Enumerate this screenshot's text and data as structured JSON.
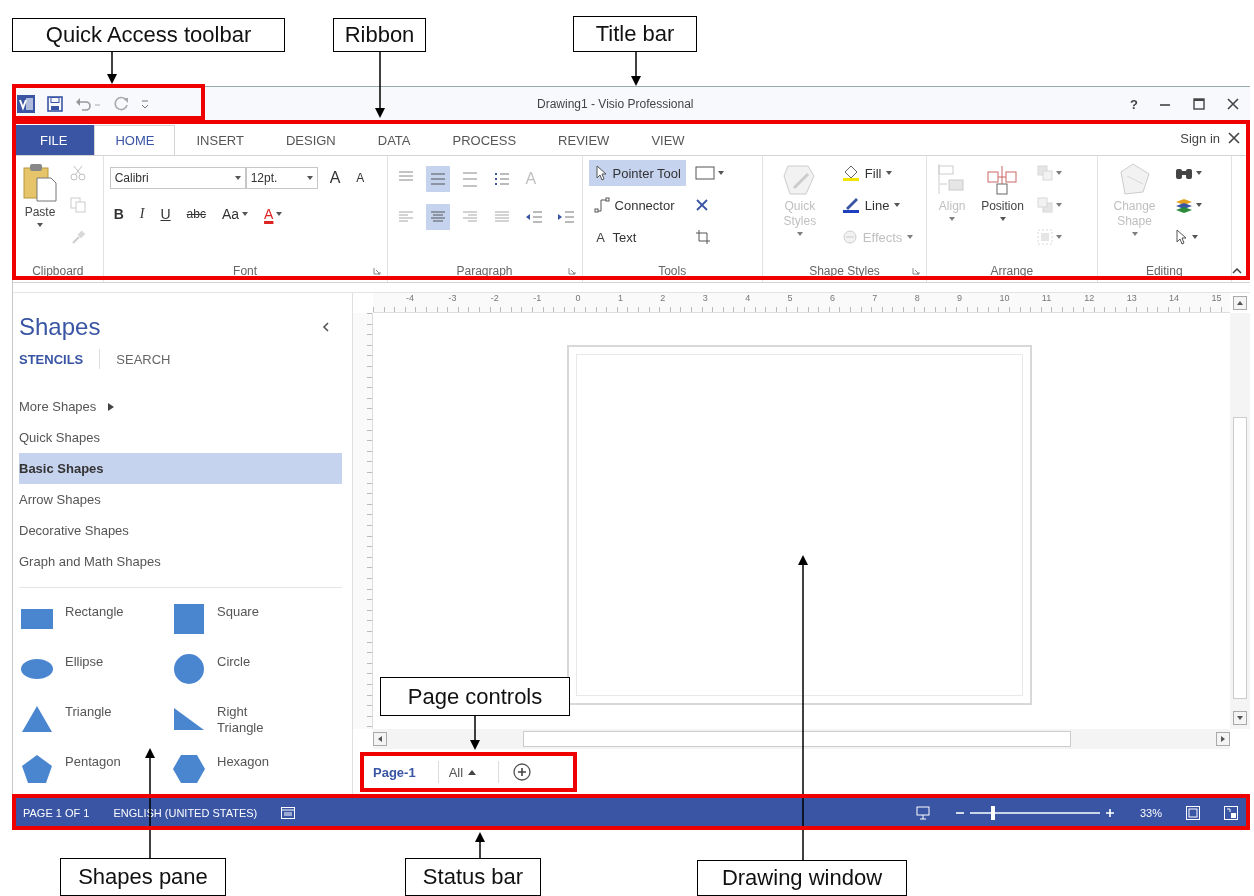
{
  "annotations": [
    {
      "label": "Quick Access toolbar",
      "highlighted": true
    },
    {
      "label": "Ribbon",
      "highlighted": true
    },
    {
      "label": "Title bar",
      "highlighted": false
    },
    {
      "label": "Page controls",
      "highlighted": true
    },
    {
      "label": "Shapes pane",
      "highlighted": false
    },
    {
      "label": "Status bar",
      "highlighted": true
    },
    {
      "label": "Drawing window",
      "highlighted": false
    }
  ],
  "window": {
    "title": "Drawing1 - Visio Professional",
    "help": "?"
  },
  "ribbon": {
    "tabs": [
      {
        "label": "FILE",
        "kind": "file",
        "selected": false
      },
      {
        "label": "HOME",
        "kind": "tab",
        "selected": true
      },
      {
        "label": "INSERT",
        "kind": "tab",
        "selected": false
      },
      {
        "label": "DESIGN",
        "kind": "tab",
        "selected": false
      },
      {
        "label": "DATA",
        "kind": "tab",
        "selected": false
      },
      {
        "label": "PROCESS",
        "kind": "tab",
        "selected": false
      },
      {
        "label": "REVIEW",
        "kind": "tab",
        "selected": false
      },
      {
        "label": "VIEW",
        "kind": "tab",
        "selected": false
      }
    ],
    "sign_in": "Sign in",
    "groups": [
      {
        "label": "Clipboard",
        "launcher": false,
        "kind": "columns",
        "lines": [
          [
            {
              "kind": "large",
              "label": "Paste",
              "dropdown": true,
              "disabled": false
            }
          ],
          [
            {
              "kind": "icon",
              "disabled": true,
              "dropdown": false
            },
            {
              "kind": "icon",
              "disabled": true,
              "dropdown": false
            },
            {
              "kind": "icon",
              "disabled": true,
              "dropdown": false
            }
          ]
        ]
      },
      {
        "label": "Font",
        "launcher": true,
        "kind": "rows",
        "lines": [
          [
            {
              "kind": "field",
              "value": "Calibri"
            },
            {
              "kind": "field",
              "value": "12pt."
            },
            {
              "kind": "glyph",
              "label": "A",
              "disabled": false,
              "dropdown": false
            },
            {
              "kind": "glyph",
              "label": "A",
              "disabled": false,
              "dropdown": false
            }
          ],
          [
            {
              "kind": "glyph",
              "label": "B",
              "disabled": false,
              "dropdown": false
            },
            {
              "kind": "glyph",
              "label": "I",
              "disabled": false,
              "dropdown": false
            },
            {
              "kind": "glyph",
              "label": "U",
              "disabled": false,
              "dropdown": false
            },
            {
              "kind": "glyph",
              "label": "abc",
              "disabled": false,
              "dropdown": false
            },
            {
              "kind": "glyph",
              "label": "Aa",
              "disabled": false,
              "dropdown": true
            },
            {
              "kind": "glyph",
              "label": "A",
              "disabled": false,
              "dropdown": true
            }
          ]
        ]
      },
      {
        "label": "Paragraph",
        "launcher": true,
        "kind": "rows",
        "lines": [
          [
            {
              "kind": "icon",
              "disabled": false,
              "selected": false
            },
            {
              "kind": "icon",
              "disabled": false,
              "selected": true
            },
            {
              "kind": "icon",
              "disabled": false,
              "selected": false
            },
            {
              "kind": "icon",
              "disabled": false,
              "selected": false
            },
            {
              "kind": "glyph",
              "label": "A",
              "disabled": true,
              "dropdown": false
            }
          ],
          [
            {
              "kind": "icon",
              "disabled": true,
              "selected": false
            },
            {
              "kind": "icon",
              "disabled": false,
              "selected": true
            },
            {
              "kind": "icon",
              "disabled": true,
              "selected": false
            },
            {
              "kind": "icon",
              "disabled": true,
              "selected": false
            },
            {
              "kind": "icon",
              "disabled": false,
              "selected": false
            },
            {
              "kind": "icon",
              "disabled": false,
              "selected": false
            }
          ]
        ]
      },
      {
        "label": "Tools",
        "launcher": false,
        "kind": "columns",
        "lines": [
          [
            {
              "kind": "small",
              "label": "Pointer Tool",
              "selected": true,
              "disabled": false,
              "dropdown": false
            },
            {
              "kind": "small",
              "label": "Connector",
              "selected": false,
              "disabled": false,
              "dropdown": false
            },
            {
              "kind": "small",
              "glyph": "A",
              "label": "Text",
              "selected": false,
              "disabled": false,
              "dropdown": false
            }
          ],
          [
            {
              "kind": "icon",
              "disabled": false,
              "dropdown": true
            },
            {
              "kind": "icon",
              "disabled": false,
              "dropdown": false
            },
            {
              "kind": "icon",
              "disabled": false,
              "dropdown": false
            }
          ]
        ]
      },
      {
        "label": "Shape Styles",
        "launcher": true,
        "kind": "columns",
        "lines": [
          [
            {
              "kind": "large",
              "label": "Quick Styles",
              "dropdown": true,
              "disabled": true
            }
          ],
          [
            {
              "kind": "small",
              "label": "Fill",
              "dropdown": true,
              "disabled": false,
              "selected": false
            },
            {
              "kind": "small",
              "label": "Line",
              "dropdown": true,
              "disabled": false,
              "selected": false
            },
            {
              "kind": "small",
              "label": "Effects",
              "dropdown": true,
              "disabled": true,
              "selected": false
            }
          ]
        ]
      },
      {
        "label": "Arrange",
        "launcher": false,
        "kind": "columns",
        "lines": [
          [
            {
              "kind": "large",
              "label": "Align",
              "dropdown": true,
              "disabled": true
            }
          ],
          [
            {
              "kind": "large",
              "label": "Position",
              "dropdown": true,
              "disabled": false
            }
          ],
          [
            {
              "kind": "icon",
              "disabled": true,
              "dropdown": true
            },
            {
              "kind": "icon",
              "disabled": true,
              "dropdown": true
            },
            {
              "kind": "icon",
              "disabled": true,
              "dropdown": true
            }
          ]
        ]
      },
      {
        "label": "Editing",
        "launcher": false,
        "kind": "columns",
        "lines": [
          [
            {
              "kind": "large",
              "label": "Change Shape",
              "dropdown": true,
              "disabled": true
            }
          ],
          [
            {
              "kind": "icon",
              "disabled": false,
              "dropdown": true
            },
            {
              "kind": "icon",
              "disabled": false,
              "dropdown": true
            },
            {
              "kind": "icon",
              "disabled": false,
              "dropdown": true
            }
          ]
        ]
      }
    ]
  },
  "shapes_pane": {
    "title": "Shapes",
    "tabs": [
      {
        "label": "STENCILS",
        "selected": true
      },
      {
        "label": "SEARCH",
        "selected": false
      }
    ],
    "stencils": [
      {
        "label": "More Shapes",
        "kind": "menu",
        "selected": false
      },
      {
        "label": "Quick Shapes",
        "kind": "stencil",
        "selected": false
      },
      {
        "label": "Basic Shapes",
        "kind": "stencil",
        "selected": true
      },
      {
        "label": "Arrow Shapes",
        "kind": "stencil",
        "selected": false
      },
      {
        "label": "Decorative Shapes",
        "kind": "stencil",
        "selected": false
      },
      {
        "label": "Graph and Math Shapes",
        "kind": "stencil",
        "selected": false
      }
    ],
    "masters": [
      {
        "label": "Rectangle"
      },
      {
        "label": "Square"
      },
      {
        "label": "Ellipse"
      },
      {
        "label": "Circle"
      },
      {
        "label": "Triangle"
      },
      {
        "label": "Right Triangle"
      },
      {
        "label": "Pentagon"
      },
      {
        "label": "Hexagon"
      }
    ]
  },
  "drawing": {
    "ruler_numbers": [
      "-4",
      "-3",
      "-2",
      "-1",
      "0",
      "1",
      "2",
      "3",
      "4",
      "5",
      "6",
      "7",
      "8",
      "9",
      "10",
      "11",
      "12",
      "13",
      "14",
      "15"
    ],
    "page_tabs": [
      {
        "label": "Page-1",
        "kind": "page",
        "selected": true
      },
      {
        "label": "All",
        "kind": "menu",
        "selected": false
      }
    ]
  },
  "status_bar": {
    "items": [
      "PAGE 1 OF 1",
      "ENGLISH (UNITED STATES)"
    ],
    "zoom": {
      "level": 0.18,
      "reading": "33%"
    }
  }
}
